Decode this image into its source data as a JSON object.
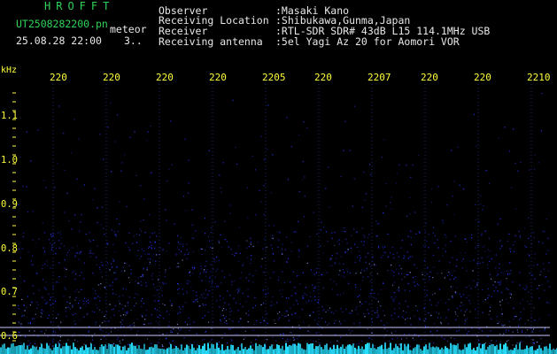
{
  "header": {
    "app_title": "HROFFT",
    "file_name": "UT2508282200.pn",
    "meteor_label": "meteor",
    "date_time": "25.08.28 22:00",
    "count": "3.."
  },
  "info": {
    "observer_label": "Observer",
    "observer_value": ":Masaki Kano",
    "location_label": "Receiving Location",
    "location_value": ":Shibukawa,Gunma,Japan",
    "receiver_label": "Receiver",
    "receiver_value": ":RTL-SDR SDR# 43dB L15 114.1MHz USB",
    "antenna_label": "Receiving antenna",
    "antenna_value": ":5el Yagi Az 20 for Aomori VOR"
  },
  "axis": {
    "unit": "kHz",
    "y_ticks": [
      "1.1",
      "1.0",
      "0.9",
      "0.8",
      "0.7",
      "0.6"
    ],
    "x_ticks": [
      "220",
      "220",
      "220",
      "220",
      "2205",
      "220",
      "2207",
      "220",
      "220",
      "2210"
    ]
  },
  "colors": {
    "background": "#000000",
    "header_green": "#2fd35a",
    "tick_yellow": "#ffff3a",
    "signal_blue": "#2a36ff",
    "noise_cyan": "#27e0ff"
  }
}
